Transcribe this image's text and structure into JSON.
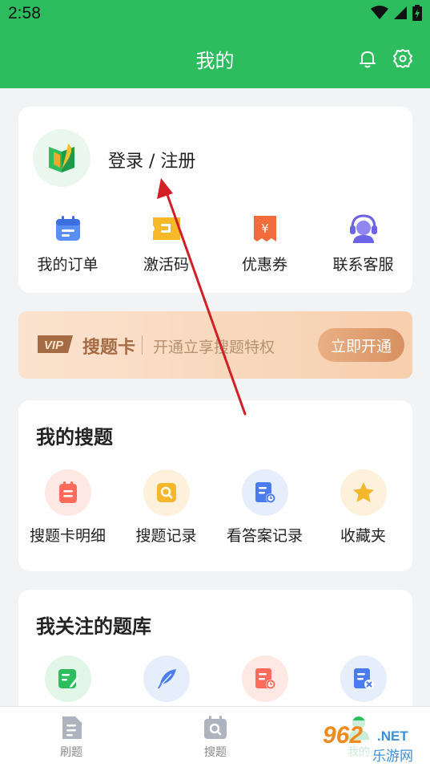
{
  "status_bar": {
    "time": "2:58"
  },
  "header": {
    "title": "我的"
  },
  "profile": {
    "login_label": "登录 / 注册"
  },
  "quick_actions": [
    {
      "label": "我的订单",
      "icon": "calendar-icon"
    },
    {
      "label": "激活码",
      "icon": "ticket-icon"
    },
    {
      "label": "优惠券",
      "icon": "coupon-icon"
    },
    {
      "label": "联系客服",
      "icon": "customer-service-icon"
    }
  ],
  "vip": {
    "badge": "VIP",
    "name": "搜题卡",
    "description": "开通立享搜题特权",
    "button_label": "立即开通"
  },
  "my_search": {
    "title": "我的搜题",
    "items": [
      {
        "label": "搜题卡明细",
        "icon": "list-icon",
        "color": "#ff6b5b"
      },
      {
        "label": "搜题记录",
        "icon": "search-record-icon",
        "color": "#f5b72c"
      },
      {
        "label": "看答案记录",
        "icon": "answer-record-icon",
        "color": "#4a7cf0"
      },
      {
        "label": "收藏夹",
        "icon": "star-icon",
        "color": "#f5b72c"
      }
    ]
  },
  "followed_banks": {
    "title": "我关注的题库",
    "items": [
      {
        "icon": "edit-icon",
        "color": "#2dbd5f"
      },
      {
        "icon": "feather-icon",
        "color": "#4a7cf0"
      },
      {
        "icon": "doc-clock-icon",
        "color": "#ff6b5b"
      },
      {
        "icon": "doc-remove-icon",
        "color": "#4a7cf0"
      }
    ]
  },
  "bottom_nav": [
    {
      "label": "刷题",
      "icon": "practice-icon"
    },
    {
      "label": "搜题",
      "icon": "search-icon"
    },
    {
      "label": "我的",
      "icon": "profile-icon"
    }
  ],
  "watermark": {
    "number": "962",
    "suffix": ".NET",
    "site": "乐游网"
  },
  "colors": {
    "brand_green": "#2dbd5f",
    "vip_text": "#a46b45",
    "annotation_red": "#d21f26"
  }
}
